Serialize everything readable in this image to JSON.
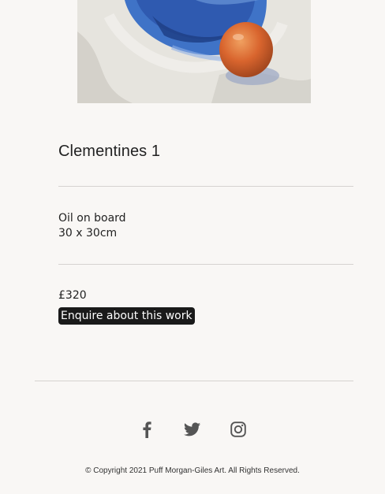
{
  "artwork": {
    "image_alt": "Clementines painting"
  },
  "work": {
    "title": "Clementines 1",
    "medium": "Oil on board",
    "size": "30 x 30cm",
    "price": "£320",
    "enquire_label": "Enquire about this work"
  },
  "footer": {
    "social": [
      {
        "name": "facebook-icon"
      },
      {
        "name": "twitter-icon"
      },
      {
        "name": "instagram-icon"
      }
    ],
    "copyright": "© Copyright 2021 Puff Morgan-Giles Art. All Rights Reserved."
  },
  "colors": {
    "background": "#f9f7f5",
    "button_bg": "#1a1a1a",
    "icon": "#555555"
  }
}
